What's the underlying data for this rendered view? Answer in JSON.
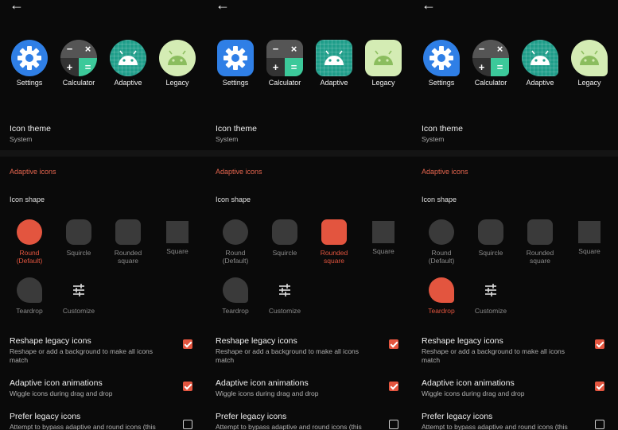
{
  "back_icon": "arrow-left-icon",
  "preview_icons": [
    {
      "label": "Settings",
      "icon": "settings-gear-icon",
      "color": "#2f7fe6"
    },
    {
      "label": "Calculator",
      "icon": "calculator-icon",
      "color": "#2c2c2c"
    },
    {
      "label": "Adaptive",
      "icon": "android-adaptive-icon",
      "color": "#1f9e8a"
    },
    {
      "label": "Legacy",
      "icon": "android-legacy-icon",
      "color": "#d4ecb4"
    }
  ],
  "calc_glyphs": [
    "−",
    "×",
    "+",
    "="
  ],
  "icon_theme": {
    "title": "Icon theme",
    "value": "System"
  },
  "section_header": "Adaptive icons",
  "icon_shape_label": "Icon shape",
  "shapes": {
    "round": "Round\n(Default)",
    "squircle": "Squircle",
    "rounded_square": "Rounded\nsquare",
    "square": "Square",
    "teardrop": "Teardrop",
    "customize": "Customize"
  },
  "settings": [
    {
      "title": "Reshape legacy icons",
      "desc": "Reshape or add a background to make all icons match",
      "checked": true
    },
    {
      "title": "Adaptive icon animations",
      "desc": "Wiggle icons during drag and drop",
      "checked": true
    },
    {
      "title": "Prefer legacy icons",
      "desc": "Attempt to bypass adaptive and round icons (this",
      "checked": false
    }
  ],
  "panels": [
    {
      "selected_shape": "round"
    },
    {
      "selected_shape": "rounded_square"
    },
    {
      "selected_shape": "teardrop"
    }
  ],
  "colors": {
    "accent": "#e3553f",
    "background": "#0a0a0a",
    "unselected_shape": "#3a3a3a"
  }
}
